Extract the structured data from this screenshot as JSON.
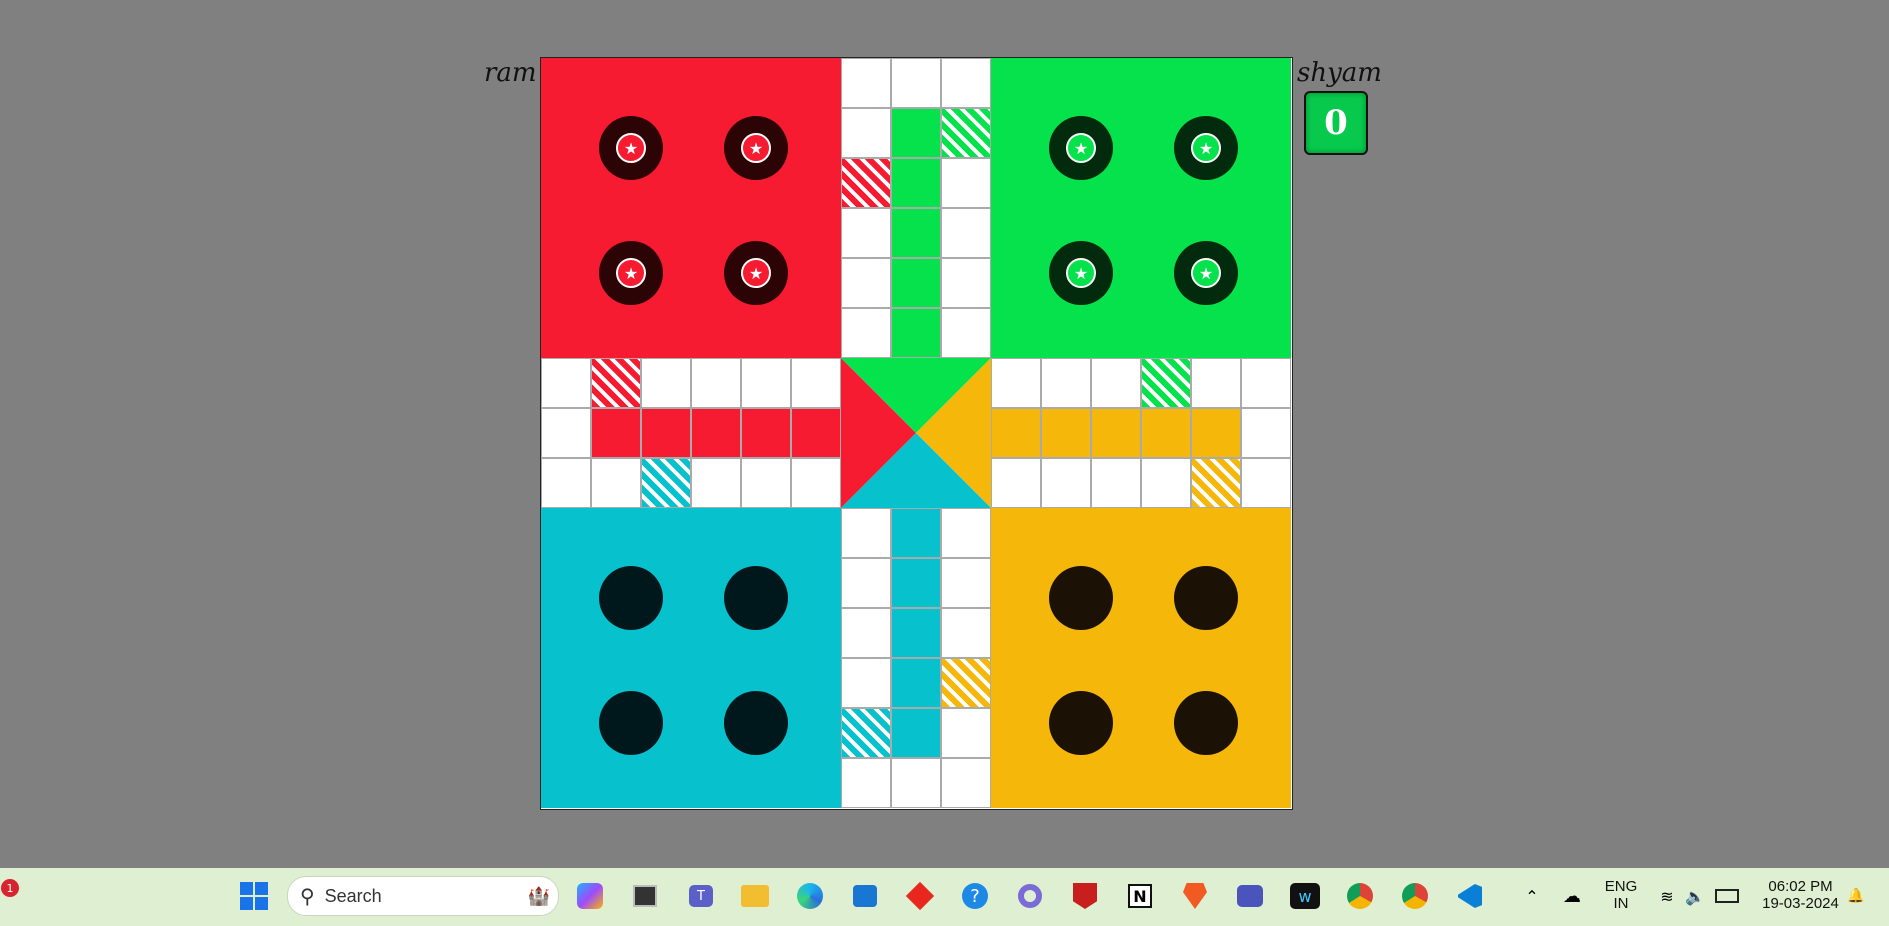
{
  "players": {
    "p1_name": "ram",
    "p2_name": "shyam"
  },
  "dice": {
    "value": "0",
    "color": "#07c94b"
  },
  "colors": {
    "red": "#f61b31",
    "green": "#05e24b",
    "yellow": "#f5b70a",
    "cyan": "#07c1cc"
  },
  "board": {
    "home_yards": [
      "red",
      "green",
      "cyan",
      "yellow"
    ],
    "token_states": {
      "red": "active",
      "green": "active",
      "cyan": "inactive",
      "yellow": "inactive"
    }
  },
  "taskbar": {
    "search_placeholder": "Search",
    "language": "ENG",
    "region": "IN",
    "time": "06:02 PM",
    "date": "19-03-2024",
    "notification_count": "1",
    "icons": [
      "windows-start-icon",
      "search-icon",
      "copilot-icon",
      "task-view-icon",
      "teams-icon",
      "file-explorer-icon",
      "edge-icon",
      "store-icon",
      "diamond-app-icon",
      "help-icon",
      "settings-app-icon",
      "mcafee-icon",
      "notion-icon",
      "brave-icon",
      "teams-work-icon",
      "webex-icon",
      "chrome-icon",
      "chrome-profile-icon",
      "vscode-icon",
      "chevron-up-icon",
      "cloud-off-icon",
      "wifi-icon",
      "volume-icon",
      "battery-icon"
    ]
  }
}
